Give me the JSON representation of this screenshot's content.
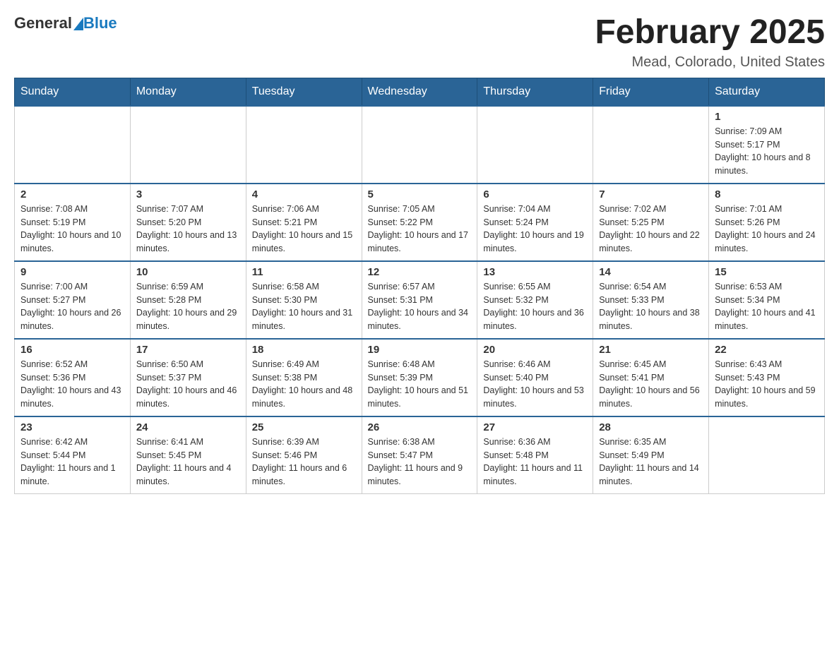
{
  "header": {
    "logo_general": "General",
    "logo_blue": "Blue",
    "month_title": "February 2025",
    "location": "Mead, Colorado, United States"
  },
  "days_of_week": [
    "Sunday",
    "Monday",
    "Tuesday",
    "Wednesday",
    "Thursday",
    "Friday",
    "Saturday"
  ],
  "weeks": [
    [
      {
        "day": "",
        "sunrise": "",
        "sunset": "",
        "daylight": ""
      },
      {
        "day": "",
        "sunrise": "",
        "sunset": "",
        "daylight": ""
      },
      {
        "day": "",
        "sunrise": "",
        "sunset": "",
        "daylight": ""
      },
      {
        "day": "",
        "sunrise": "",
        "sunset": "",
        "daylight": ""
      },
      {
        "day": "",
        "sunrise": "",
        "sunset": "",
        "daylight": ""
      },
      {
        "day": "",
        "sunrise": "",
        "sunset": "",
        "daylight": ""
      },
      {
        "day": "1",
        "sunrise": "Sunrise: 7:09 AM",
        "sunset": "Sunset: 5:17 PM",
        "daylight": "Daylight: 10 hours and 8 minutes."
      }
    ],
    [
      {
        "day": "2",
        "sunrise": "Sunrise: 7:08 AM",
        "sunset": "Sunset: 5:19 PM",
        "daylight": "Daylight: 10 hours and 10 minutes."
      },
      {
        "day": "3",
        "sunrise": "Sunrise: 7:07 AM",
        "sunset": "Sunset: 5:20 PM",
        "daylight": "Daylight: 10 hours and 13 minutes."
      },
      {
        "day": "4",
        "sunrise": "Sunrise: 7:06 AM",
        "sunset": "Sunset: 5:21 PM",
        "daylight": "Daylight: 10 hours and 15 minutes."
      },
      {
        "day": "5",
        "sunrise": "Sunrise: 7:05 AM",
        "sunset": "Sunset: 5:22 PM",
        "daylight": "Daylight: 10 hours and 17 minutes."
      },
      {
        "day": "6",
        "sunrise": "Sunrise: 7:04 AM",
        "sunset": "Sunset: 5:24 PM",
        "daylight": "Daylight: 10 hours and 19 minutes."
      },
      {
        "day": "7",
        "sunrise": "Sunrise: 7:02 AM",
        "sunset": "Sunset: 5:25 PM",
        "daylight": "Daylight: 10 hours and 22 minutes."
      },
      {
        "day": "8",
        "sunrise": "Sunrise: 7:01 AM",
        "sunset": "Sunset: 5:26 PM",
        "daylight": "Daylight: 10 hours and 24 minutes."
      }
    ],
    [
      {
        "day": "9",
        "sunrise": "Sunrise: 7:00 AM",
        "sunset": "Sunset: 5:27 PM",
        "daylight": "Daylight: 10 hours and 26 minutes."
      },
      {
        "day": "10",
        "sunrise": "Sunrise: 6:59 AM",
        "sunset": "Sunset: 5:28 PM",
        "daylight": "Daylight: 10 hours and 29 minutes."
      },
      {
        "day": "11",
        "sunrise": "Sunrise: 6:58 AM",
        "sunset": "Sunset: 5:30 PM",
        "daylight": "Daylight: 10 hours and 31 minutes."
      },
      {
        "day": "12",
        "sunrise": "Sunrise: 6:57 AM",
        "sunset": "Sunset: 5:31 PM",
        "daylight": "Daylight: 10 hours and 34 minutes."
      },
      {
        "day": "13",
        "sunrise": "Sunrise: 6:55 AM",
        "sunset": "Sunset: 5:32 PM",
        "daylight": "Daylight: 10 hours and 36 minutes."
      },
      {
        "day": "14",
        "sunrise": "Sunrise: 6:54 AM",
        "sunset": "Sunset: 5:33 PM",
        "daylight": "Daylight: 10 hours and 38 minutes."
      },
      {
        "day": "15",
        "sunrise": "Sunrise: 6:53 AM",
        "sunset": "Sunset: 5:34 PM",
        "daylight": "Daylight: 10 hours and 41 minutes."
      }
    ],
    [
      {
        "day": "16",
        "sunrise": "Sunrise: 6:52 AM",
        "sunset": "Sunset: 5:36 PM",
        "daylight": "Daylight: 10 hours and 43 minutes."
      },
      {
        "day": "17",
        "sunrise": "Sunrise: 6:50 AM",
        "sunset": "Sunset: 5:37 PM",
        "daylight": "Daylight: 10 hours and 46 minutes."
      },
      {
        "day": "18",
        "sunrise": "Sunrise: 6:49 AM",
        "sunset": "Sunset: 5:38 PM",
        "daylight": "Daylight: 10 hours and 48 minutes."
      },
      {
        "day": "19",
        "sunrise": "Sunrise: 6:48 AM",
        "sunset": "Sunset: 5:39 PM",
        "daylight": "Daylight: 10 hours and 51 minutes."
      },
      {
        "day": "20",
        "sunrise": "Sunrise: 6:46 AM",
        "sunset": "Sunset: 5:40 PM",
        "daylight": "Daylight: 10 hours and 53 minutes."
      },
      {
        "day": "21",
        "sunrise": "Sunrise: 6:45 AM",
        "sunset": "Sunset: 5:41 PM",
        "daylight": "Daylight: 10 hours and 56 minutes."
      },
      {
        "day": "22",
        "sunrise": "Sunrise: 6:43 AM",
        "sunset": "Sunset: 5:43 PM",
        "daylight": "Daylight: 10 hours and 59 minutes."
      }
    ],
    [
      {
        "day": "23",
        "sunrise": "Sunrise: 6:42 AM",
        "sunset": "Sunset: 5:44 PM",
        "daylight": "Daylight: 11 hours and 1 minute."
      },
      {
        "day": "24",
        "sunrise": "Sunrise: 6:41 AM",
        "sunset": "Sunset: 5:45 PM",
        "daylight": "Daylight: 11 hours and 4 minutes."
      },
      {
        "day": "25",
        "sunrise": "Sunrise: 6:39 AM",
        "sunset": "Sunset: 5:46 PM",
        "daylight": "Daylight: 11 hours and 6 minutes."
      },
      {
        "day": "26",
        "sunrise": "Sunrise: 6:38 AM",
        "sunset": "Sunset: 5:47 PM",
        "daylight": "Daylight: 11 hours and 9 minutes."
      },
      {
        "day": "27",
        "sunrise": "Sunrise: 6:36 AM",
        "sunset": "Sunset: 5:48 PM",
        "daylight": "Daylight: 11 hours and 11 minutes."
      },
      {
        "day": "28",
        "sunrise": "Sunrise: 6:35 AM",
        "sunset": "Sunset: 5:49 PM",
        "daylight": "Daylight: 11 hours and 14 minutes."
      },
      {
        "day": "",
        "sunrise": "",
        "sunset": "",
        "daylight": ""
      }
    ]
  ]
}
